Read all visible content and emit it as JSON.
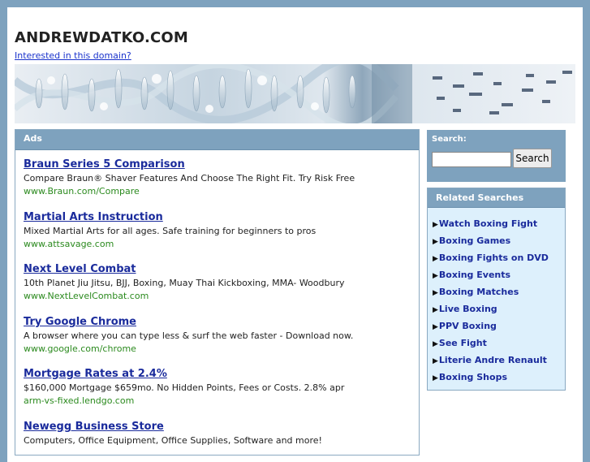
{
  "header": {
    "domain": "ANDREWDATKO.COM",
    "interest_link": "Interested in this domain?"
  },
  "ads": {
    "heading": "Ads",
    "items": [
      {
        "title": "Braun Series 5 Comparison",
        "desc": "Compare Braun® Shaver Features And Choose The Right Fit. Try Risk Free",
        "url": "www.Braun.com/Compare"
      },
      {
        "title": "Martial Arts Instruction",
        "desc": "Mixed Martial Arts for all ages. Safe training for beginners to pros",
        "url": "www.attsavage.com"
      },
      {
        "title": "Next Level Combat",
        "desc": "10th Planet Jiu Jitsu, BJJ, Boxing, Muay Thai Kickboxing, MMA- Woodbury",
        "url": "www.NextLevelCombat.com"
      },
      {
        "title": "Try Google Chrome",
        "desc": "A browser where you can type less & surf the web faster - Download now.",
        "url": "www.google.com/chrome"
      },
      {
        "title": "Mortgage Rates at 2.4%",
        "desc": "$160,000 Mortgage $659mo. No Hidden Points, Fees or Costs. 2.8% apr",
        "url": "arm-vs-fixed.lendgo.com"
      },
      {
        "title": "Newegg Business Store",
        "desc": "Computers, Office Equipment, Office Supplies, Software and more!",
        "url": ""
      }
    ]
  },
  "search": {
    "label": "Search:",
    "value": "",
    "button": "Search"
  },
  "related": {
    "heading": "Related Searches",
    "arrow": "▶",
    "items": [
      "Watch Boxing Fight",
      "Boxing Games",
      "Boxing Fights on DVD",
      "Boxing Events",
      "Boxing Matches",
      "Live Boxing",
      "PPV Boxing",
      "See Fight",
      "Literie Andre Renault",
      "Boxing Shops"
    ]
  }
}
